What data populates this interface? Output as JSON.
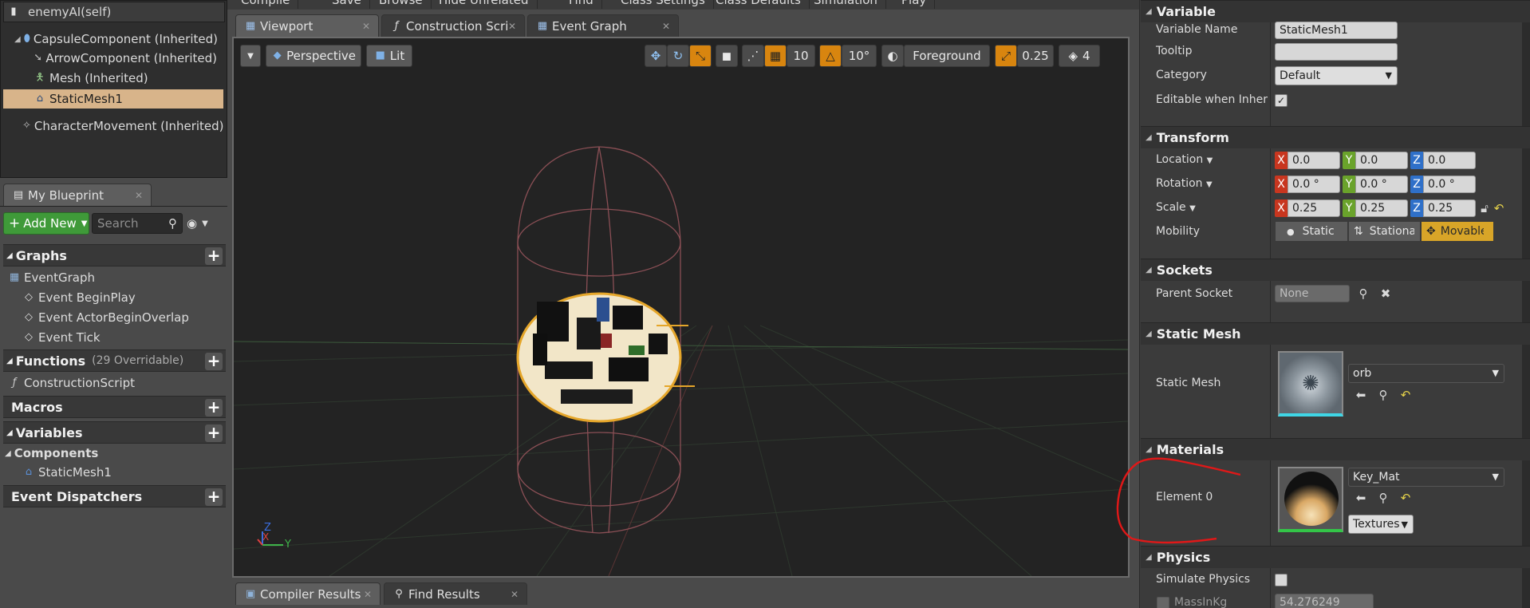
{
  "top_menu": [
    "Compile",
    "Save",
    "Browse",
    "Hide Unrelated",
    "Find",
    "Class Settings",
    "Class Defaults",
    "Simulation",
    "Play"
  ],
  "components": {
    "header": "enemyAI(self)",
    "items": [
      {
        "label": "CapsuleComponent (Inherited)",
        "icon": "capsule-icon"
      },
      {
        "label": "ArrowComponent (Inherited)",
        "icon": "arrow-icon"
      },
      {
        "label": "Mesh (Inherited)",
        "icon": "mesh-person-icon"
      },
      {
        "label": "StaticMesh1",
        "icon": "static-mesh-icon",
        "selected": true
      },
      {
        "label": "CharacterMovement (Inherited)",
        "icon": "character-movement-icon"
      }
    ]
  },
  "my_blueprint": {
    "tab_label": "My Blueprint",
    "add_new": "Add New",
    "search_placeholder": "Search",
    "sections": {
      "graphs": "Graphs",
      "functions": "Functions",
      "functions_note": "(29 Overridable)",
      "macros": "Macros",
      "variables": "Variables",
      "event_dispatchers": "Event Dispatchers"
    },
    "graph_items": [
      "EventGraph",
      "Event BeginPlay",
      "Event ActorBeginOverlap",
      "Event Tick"
    ],
    "function_items": [
      "ConstructionScript"
    ],
    "components_label": "Components",
    "component_vars": [
      "StaticMesh1"
    ]
  },
  "editor_tabs": [
    "Viewport",
    "Construction Script",
    "Event Graph"
  ],
  "viewport_toolbar": {
    "perspective": "Perspective",
    "lit": "Lit",
    "grid_snap": "10",
    "rotation_snap": "10°",
    "layer": "Foreground",
    "scale_snap": "0.25",
    "camera_speed": "4"
  },
  "bottom_tabs": [
    "Compiler Results",
    "Find Results"
  ],
  "axis_gizmo": {
    "x": "X",
    "y": "Y",
    "z": "Z"
  },
  "details": {
    "variable": {
      "title": "Variable",
      "variable_name_label": "Variable Name",
      "variable_name": "StaticMesh1",
      "tooltip_label": "Tooltip",
      "tooltip_value": "",
      "category_label": "Category",
      "category_value": "Default",
      "editable_label": "Editable when Inherited"
    },
    "transform": {
      "title": "Transform",
      "location_label": "Location",
      "rotation_label": "Rotation",
      "scale_label": "Scale",
      "mobility_label": "Mobility",
      "location": [
        "0.0",
        "0.0",
        "0.0"
      ],
      "rotation": [
        "0.0 °",
        "0.0 °",
        "0.0 °"
      ],
      "scale": [
        "0.25",
        "0.25",
        "0.25"
      ],
      "mobility_options": [
        "Static",
        "Stationary",
        "Movable"
      ],
      "mobility_selected": "Movable"
    },
    "sockets": {
      "title": "Sockets",
      "parent_socket_label": "Parent Socket",
      "parent_socket_value": "None"
    },
    "static_mesh": {
      "title": "Static Mesh",
      "label": "Static Mesh",
      "value": "orb"
    },
    "materials": {
      "title": "Materials",
      "element_label": "Element 0",
      "value": "Key_Mat",
      "textures_label": "Textures"
    },
    "physics": {
      "title": "Physics",
      "simulate_label": "Simulate Physics",
      "mass_label": "MassInKg",
      "mass_value": "54.276249"
    }
  },
  "colors": {
    "selection": "#d8b48a",
    "accent_orange": "#d8850f",
    "add_new_green": "#3f9a39",
    "annotation_red": "#e01818"
  }
}
